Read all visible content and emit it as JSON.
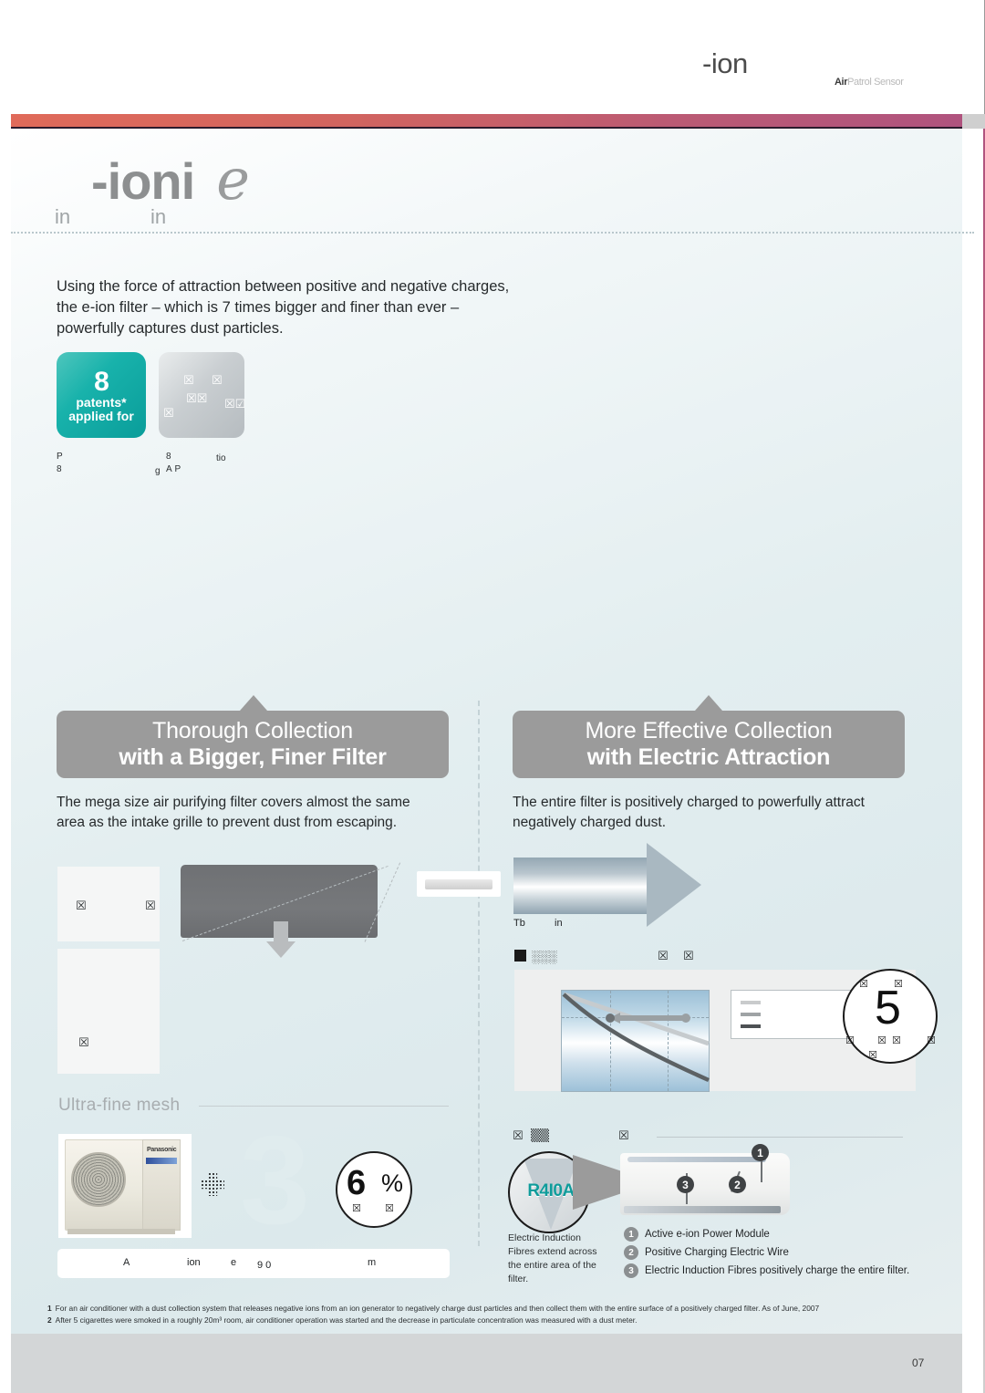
{
  "masthead": {
    "title": "-ion",
    "sub_dark": "Air",
    "sub_light": "Patrol Sensor",
    "sub_combined": "Air Patrol Sensor"
  },
  "headline": {
    "main": "-ioni",
    "script": "e",
    "sub_a": "in",
    "sub_b": "in"
  },
  "intro": {
    "text": "Using the force of attraction between positive and negative charges, the e-ion filter – which is 7 times bigger and finer than ever – powerfully captures dust particles."
  },
  "badges": {
    "teal": {
      "number": "8",
      "line1": "patents*",
      "line2": "applied for"
    },
    "grey": {
      "g1": "☒",
      "g2": "☒",
      "g3": "☒☒",
      "g4": "☒☑",
      "g5": "☒"
    },
    "caption": {
      "r1": "P",
      "r1b": "8",
      "r1c": "tio",
      "r2": "8",
      "r2b": "g",
      "r2c": "A P"
    }
  },
  "left_panel": {
    "head_line1": "Thorough Collection",
    "head_line2": "with a Bigger, Finer Filter",
    "body": "The mega size air purifying filter covers almost the same area as the intake grille to prevent dust from escaping.",
    "box_top": {
      "g1": "☒",
      "g2": "☒"
    },
    "box_bot": {
      "g1": "☒"
    },
    "ultra_label": "Ultra-fine mesh",
    "big_number": "3",
    "circle_badge": {
      "number": "6",
      "percent": "%",
      "t1": "☒",
      "t2": "☒"
    },
    "strip": {
      "s1": "A",
      "s2": "ion",
      "s3": "e",
      "s4": "　9 0",
      "s5": "m"
    }
  },
  "right_panel": {
    "head_line1": "More Effective Collection",
    "head_line2": "with Electric Attraction",
    "body": "The entire filter is positively charged to powerfully attract negatively charged dust.",
    "arrow_cap_a": "Tb",
    "arrow_cap_b": "in",
    "legend_sq_label": "░░░",
    "legend_t1": "☒",
    "legend_t2": "☒",
    "circle5": {
      "number": "5",
      "t_a": "☒",
      "t_b": "☒",
      "t_c": "☒",
      "t_d": "☒",
      "t_e": "☒",
      "t_f": "☒",
      "t_g": "☒"
    },
    "rp_t1": "☒",
    "rp_t2": "▒▒",
    "rp_t3": "☒",
    "r410a_logo": "R4I0A",
    "sidenote": "Electric Induction Fibres extend across the entire area of the filter.",
    "numbered_items": [
      {
        "n": "1",
        "text": "Active e-ion Power Module"
      },
      {
        "n": "2",
        "text": "Positive Charging Electric Wire"
      },
      {
        "n": "3",
        "text": "Electric Induction Fibres positively charge the entire filter."
      }
    ]
  },
  "footnotes": [
    {
      "num": "1",
      "text": "For an air conditioner with a dust collection system that releases negative ions from an ion generator to negatively charge dust particles and then collect them with the entire surface of a positively charged filter. As of June, 2007"
    },
    {
      "num": "2",
      "text": "After 5 cigarettes were smoked in a roughly 20m³ room, air conditioner operation was started and the decrease in particulate concentration was measured with a dust meter."
    }
  ],
  "page_number": "07",
  "colors": {
    "teal": "#0a9d9a",
    "accent_bar_start": "#e06a5a",
    "accent_bar_end": "#b0537e",
    "panel_head": "#9b9b9b",
    "body_bg": "#e3eef0"
  }
}
